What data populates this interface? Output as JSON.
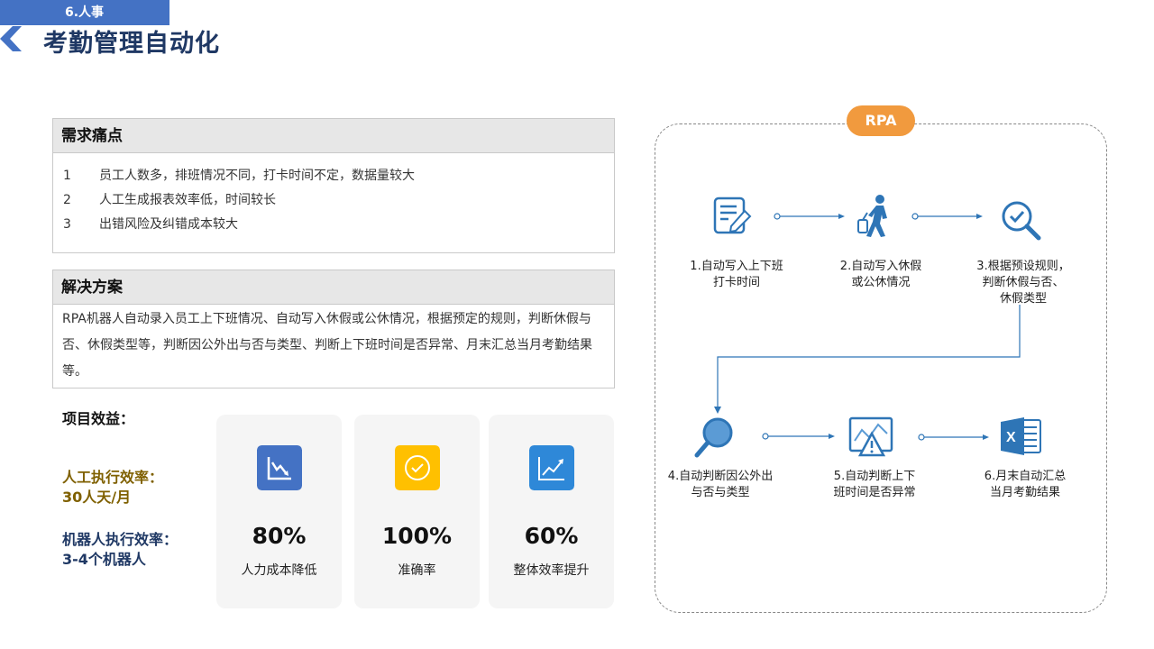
{
  "header": {
    "section_tag": "6.人事",
    "title": "考勤管理自动化"
  },
  "pain_points": {
    "title": "需求痛点",
    "items": [
      {
        "num": "1",
        "text": "员工人数多，排班情况不同，打卡时间不定，数据量较大"
      },
      {
        "num": "2",
        "text": "人工生成报表效率低，时间较长"
      },
      {
        "num": "3",
        "text": "出错风险及纠错成本较大"
      }
    ]
  },
  "solution": {
    "title": "解决方案",
    "text": "RPA机器人自动录入员工上下班情况、自动写入休假或公休情况，根据预定的规则，判断休假与否、休假类型等，判断因公外出与否与类型、判断上下班时间是否异常、月末汇总当月考勤结果等。"
  },
  "benefits": {
    "title": "项目效益：",
    "manual_efficiency": {
      "line1": "人工执行效率：",
      "line2": "30人天/月"
    },
    "robot_efficiency": {
      "line1": "机器人执行效率：",
      "line2": "3-4个机器人"
    },
    "cards": [
      {
        "value": "80%",
        "label": "人力成本降低",
        "icon": "chart-down-icon",
        "color": "#4472c4"
      },
      {
        "value": "100%",
        "label": "准确率",
        "icon": "check-circle-icon",
        "color": "#ffc000"
      },
      {
        "value": "60%",
        "label": "整体效率提升",
        "icon": "chart-up-icon",
        "color": "#2e88d8"
      }
    ]
  },
  "flow": {
    "badge": "RPA",
    "steps": [
      {
        "line1": "1.自动写入上下班",
        "line2": "打卡时间",
        "line3": "",
        "icon": "edit-document-icon"
      },
      {
        "line1": "2.自动写入休假",
        "line2": "或公休情况",
        "line3": "",
        "icon": "traveler-icon"
      },
      {
        "line1": "3.根据预设规则，",
        "line2": "判断休假与否、",
        "line3": "休假类型",
        "icon": "search-check-icon"
      },
      {
        "line1": "4.自动判断因公外出",
        "line2": "与否与类型",
        "line3": "",
        "icon": "magnifier-icon"
      },
      {
        "line1": "5.自动判断上下",
        "line2": "班时间是否异常",
        "line3": "",
        "icon": "warning-chart-icon"
      },
      {
        "line1": "6.月末自动汇总",
        "line2": "当月考勤结果",
        "line3": "",
        "icon": "excel-icon"
      }
    ]
  },
  "colors": {
    "accent_blue": "#4472c4",
    "title_navy": "#1f3864",
    "badge_orange": "#f19a3e",
    "flow_blue": "#2e75b6",
    "manual_gold": "#7f6000"
  }
}
